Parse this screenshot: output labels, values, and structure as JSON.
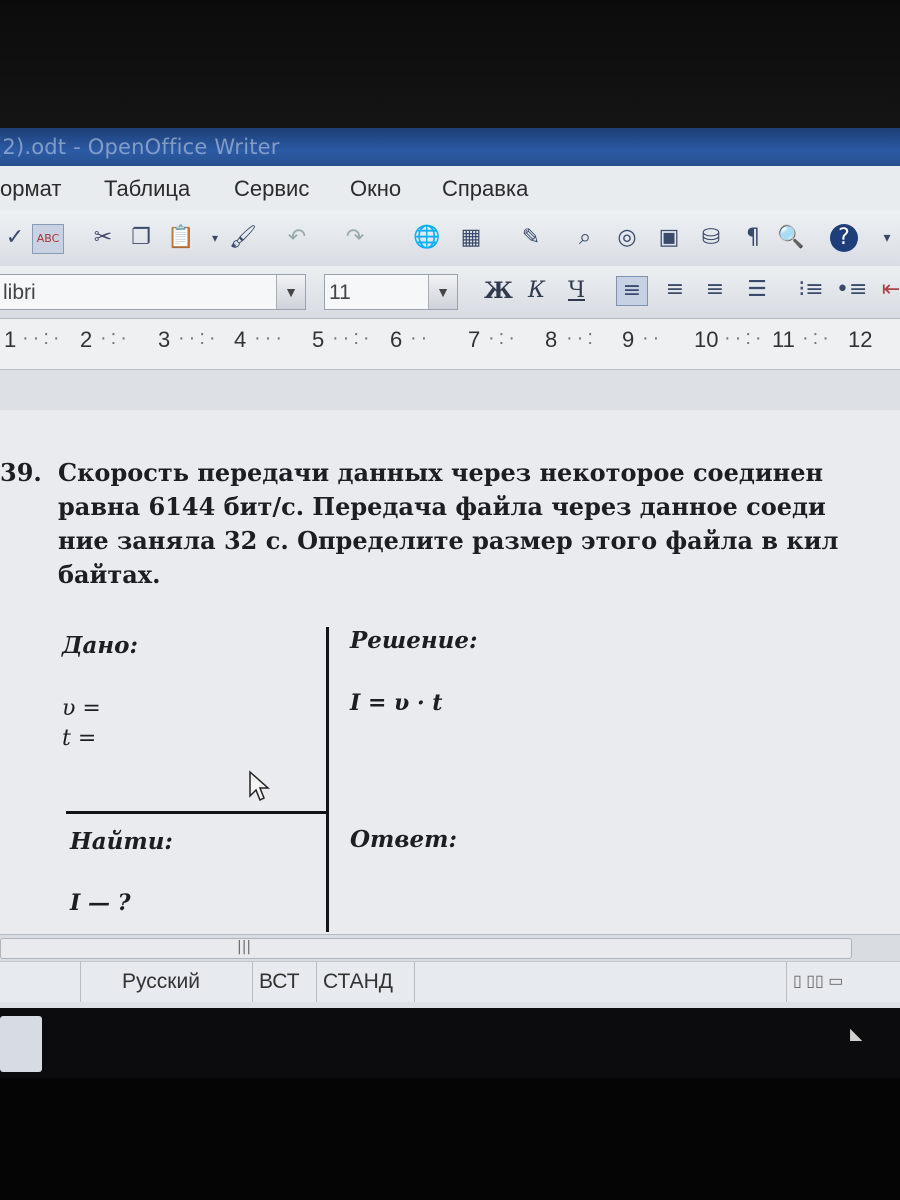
{
  "window": {
    "title": "(2).odt - OpenOffice Writer"
  },
  "menu": [
    "ормат",
    "Таблица",
    "Сервис",
    "Окно",
    "Справка"
  ],
  "format_bar": {
    "font_name": "libri",
    "font_size": "11",
    "bold_label": "Ж",
    "italic_label": "К",
    "underline_label": "Ч"
  },
  "ruler": [
    "1",
    "2",
    "3",
    "4",
    "5",
    "6",
    "7",
    "8",
    "9",
    "10",
    "11",
    "12"
  ],
  "document": {
    "problem_number": "39.",
    "problem_lines": [
      "Скорость передачи данных через некоторое соединен",
      "равна 6144 бит/с. Передача файла через данное соеди",
      "ние заняла 32 с. Определите размер этого файла в кил",
      "байтах."
    ],
    "given_label": "Дано:",
    "given_v": "υ =",
    "given_t": "t =",
    "find_label": "Найти:",
    "find_value": "I — ?",
    "solution_label": "Решение:",
    "solution_formula": "I = υ · t",
    "answer_label": "Ответ:"
  },
  "statusbar": {
    "language": "Русский",
    "insert_mode": "ВСТ",
    "selection_mode": "СТАНД"
  },
  "colors": {
    "title_bar": "#2c5aa5",
    "page": "#e9ebee",
    "text": "#1d1d22"
  }
}
